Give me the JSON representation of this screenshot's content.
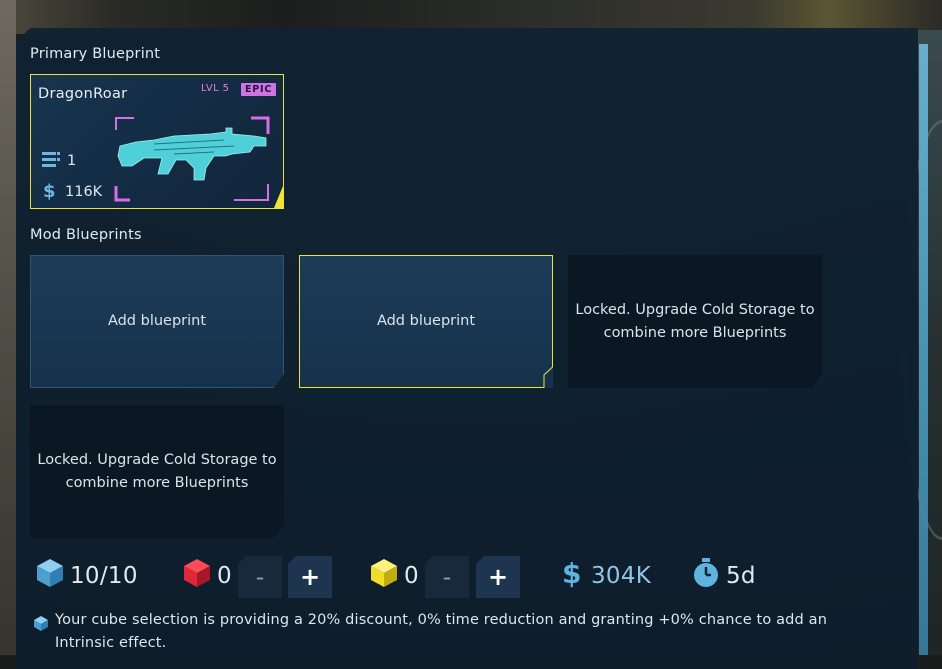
{
  "primary": {
    "section_label": "Primary Blueprint",
    "name": "DragonRoar",
    "level": "LVL 5",
    "rarity": "EPIC",
    "count": "1",
    "value": "116K",
    "icons": {
      "count": "stack-icon",
      "value": "credits-icon",
      "image": "assault-rifle-icon"
    },
    "colors": {
      "border": "#e8e23a",
      "rarity": "#cf72e3",
      "weapon": "#4fd0d8"
    }
  },
  "mods": {
    "section_label": "Mod Blueprints",
    "slots": [
      {
        "text": "Add blueprint",
        "state": "open"
      },
      {
        "text": "Add blueprint",
        "state": "selected"
      },
      {
        "text": "Locked. Upgrade Cold Storage to combine more Blueprints",
        "state": "locked"
      },
      {
        "text": "Locked. Upgrade Cold Storage to combine more Blueprints",
        "state": "locked"
      }
    ]
  },
  "resources": {
    "blue_cube": {
      "icon": "blue-cube-icon",
      "value": "10/10",
      "color": "#5fb3e0"
    },
    "red_cube": {
      "icon": "red-cube-icon",
      "value": "0",
      "minus": "-",
      "plus": "+",
      "color": "#e0273a"
    },
    "yellow_cube": {
      "icon": "yellow-cube-icon",
      "value": "0",
      "minus": "-",
      "plus": "+",
      "color": "#f1dd2a"
    },
    "cost": {
      "icon": "credits-icon",
      "value": "304K",
      "color": "#5fb3e0"
    },
    "time": {
      "icon": "stopwatch-icon",
      "value": "5d",
      "color": "#5fb3e0"
    }
  },
  "note": {
    "icon": "cube-icon",
    "text": "Your cube selection is providing a 20% discount, 0% time reduction and granting +0% chance to add an Intrinsic effect."
  }
}
